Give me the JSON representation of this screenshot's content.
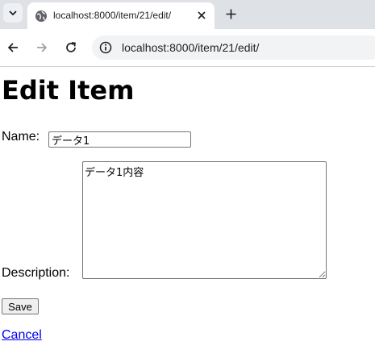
{
  "browser": {
    "tab_title": "localhost:8000/item/21/edit/",
    "url": "localhost:8000/item/21/edit/",
    "icons": {
      "tab_menu": "chevron-down-icon",
      "favicon": "globe-icon",
      "close": "close-icon",
      "new_tab": "plus-icon",
      "back": "arrow-left-icon",
      "forward": "arrow-right-icon",
      "reload": "reload-icon",
      "site_info": "info-icon"
    }
  },
  "page": {
    "heading": "Edit Item",
    "name_label": "Name:",
    "name_value": "データ1",
    "description_label": "Description:",
    "description_value": "データ1内容",
    "save_label": "Save",
    "cancel_label": "Cancel"
  },
  "colors": {
    "link": "#0000ee",
    "tabstrip_bg": "#dee1e6",
    "omnibox_bg": "#f1f3f4"
  }
}
